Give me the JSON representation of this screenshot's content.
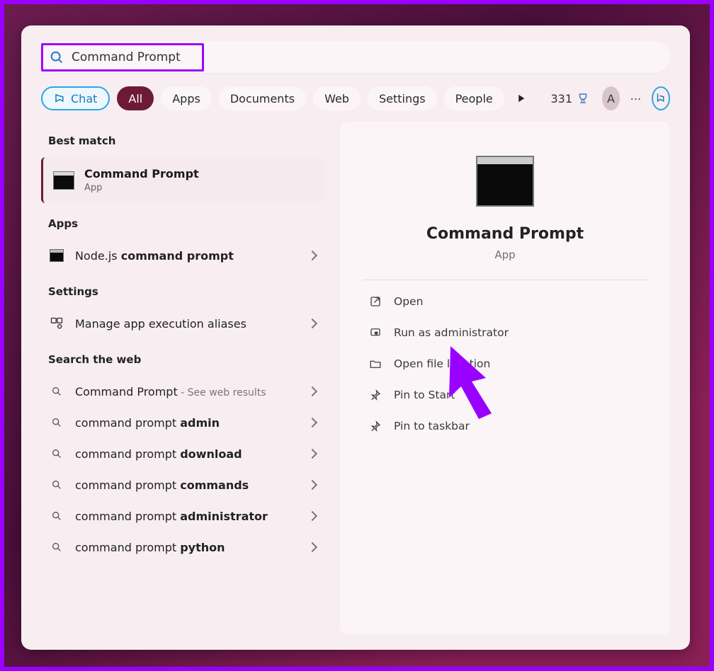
{
  "search": {
    "query": "Command Prompt"
  },
  "filters": {
    "chat": "Chat",
    "all": "All",
    "apps": "Apps",
    "documents": "Documents",
    "web": "Web",
    "settings": "Settings",
    "people": "People"
  },
  "header": {
    "rewards_count": "331",
    "avatar_initial": "A"
  },
  "sections": {
    "best_match": "Best match",
    "apps": "Apps",
    "settings": "Settings",
    "search_web": "Search the web"
  },
  "best": {
    "title": "Command Prompt",
    "subtitle": "App"
  },
  "apps_list": [
    {
      "prefix": "Node.js ",
      "bold": "command prompt"
    }
  ],
  "settings_list": [
    {
      "text": "Manage app execution aliases"
    }
  ],
  "web_list": [
    {
      "prefix": "Command Prompt",
      "bold": "",
      "suffix": " - See web results"
    },
    {
      "prefix": "command prompt ",
      "bold": "admin",
      "suffix": ""
    },
    {
      "prefix": "command prompt ",
      "bold": "download",
      "suffix": ""
    },
    {
      "prefix": "command prompt ",
      "bold": "commands",
      "suffix": ""
    },
    {
      "prefix": "command prompt ",
      "bold": "administrator",
      "suffix": ""
    },
    {
      "prefix": "command prompt ",
      "bold": "python",
      "suffix": ""
    }
  ],
  "preview": {
    "title": "Command Prompt",
    "subtitle": "App",
    "actions": [
      {
        "icon": "open",
        "label": "Open"
      },
      {
        "icon": "admin",
        "label": "Run as administrator"
      },
      {
        "icon": "folder",
        "label": "Open file location"
      },
      {
        "icon": "pin",
        "label": "Pin to Start"
      },
      {
        "icon": "pin",
        "label": "Pin to taskbar"
      }
    ]
  }
}
